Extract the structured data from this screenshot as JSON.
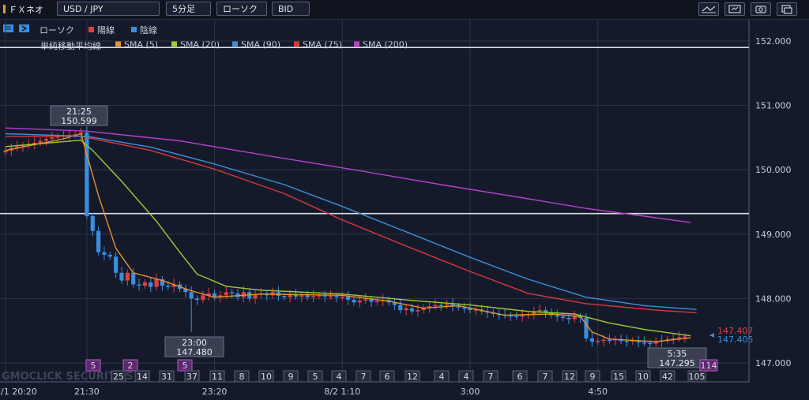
{
  "toolbar": {
    "app_name": "ＦＸネオ",
    "pair": "USD / JPY",
    "timeframe": "5分足",
    "chart_style": "ローソク",
    "price_side": "BID"
  },
  "legend": {
    "candle_label": "ローソク",
    "up_label": "陽線",
    "down_label": "陰線",
    "indicator_label": "単純移動平均線",
    "sma": [
      {
        "label": "SMA (5)",
        "color": "#e8922e"
      },
      {
        "label": "SMA (20)",
        "color": "#9acd32"
      },
      {
        "label": "SMA (90)",
        "color": "#3d8fd8"
      },
      {
        "label": "SMA (75)",
        "color": "#d63a3a"
      },
      {
        "label": "SMA (200)",
        "color": "#b640c8"
      }
    ]
  },
  "colors": {
    "up": "#e04040",
    "down": "#3a8ee0",
    "background": "#151a2b",
    "grid": "#2e3448"
  },
  "watermark": "GMOCLICK SECURITIES",
  "chart_data": {
    "type": "candlestick",
    "ylim": [
      146.7,
      152.3
    ],
    "y_ticks": [
      "152.000",
      "151.000",
      "150.000",
      "149.000",
      "148.000",
      "147.000"
    ],
    "x_tick_labels": [
      "/1 20:20",
      "21:30",
      "23:20",
      "8/2 1:10",
      "3:00",
      "4:50"
    ],
    "x_tick_index": [
      0,
      14,
      36,
      58,
      80,
      102
    ],
    "horizontal_lines": [
      151.9,
      149.32
    ],
    "high_annotation": {
      "time": "21:25",
      "price": "150.599",
      "index": 13
    },
    "low_annotation": {
      "time": "23:00",
      "price": "147.480",
      "index": 32
    },
    "last_low_annotation": {
      "time": "5:35",
      "price": "147.295",
      "index": 111
    },
    "last_price_sell": "147.407",
    "last_price_buy": "147.405",
    "count_badges": [
      "5",
      "2",
      "5",
      "25",
      "14",
      "31",
      "37",
      "11",
      "8",
      "10",
      "9",
      "5",
      "4",
      "7",
      "6",
      "12",
      "4",
      "4",
      "7",
      "6",
      "7",
      "12",
      "9",
      "15",
      "10",
      "42",
      "105",
      "114"
    ],
    "closes": [
      150.3,
      150.34,
      150.36,
      150.38,
      150.4,
      150.42,
      150.45,
      150.48,
      150.5,
      150.52,
      150.53,
      150.54,
      150.55,
      150.58,
      149.28,
      149.05,
      148.72,
      148.68,
      148.65,
      148.4,
      148.28,
      148.4,
      148.22,
      148.2,
      148.25,
      148.18,
      148.3,
      148.2,
      148.18,
      148.22,
      148.15,
      148.1,
      148.0,
      147.98,
      148.05,
      148.08,
      148.02,
      148.05,
      148.1,
      148.08,
      148.02,
      148.1,
      148.0,
      148.06,
      148.08,
      148.05,
      148.1,
      148.04,
      148.02,
      148.06,
      148.03,
      148.05,
      148.02,
      148.04,
      148.05,
      148.03,
      148.04,
      148.02,
      148.03,
      147.98,
      147.94,
      147.97,
      147.99,
      147.95,
      147.96,
      147.98,
      147.94,
      147.9,
      147.82,
      147.85,
      147.8,
      147.82,
      147.86,
      147.88,
      147.9,
      147.89,
      147.91,
      147.88,
      147.86,
      147.85,
      147.82,
      147.83,
      147.8,
      147.78,
      147.76,
      147.75,
      147.74,
      147.73,
      147.72,
      147.74,
      147.76,
      147.8,
      147.82,
      147.78,
      147.74,
      147.72,
      147.7,
      147.68,
      147.72,
      147.7,
      147.38,
      147.33,
      147.34,
      147.36,
      147.35,
      147.37,
      147.34,
      147.33,
      147.35,
      147.32,
      147.31,
      147.3,
      147.33,
      147.35,
      147.37,
      147.38,
      147.4,
      147.41
    ],
    "series": [
      {
        "name": "SMA (5)",
        "color": "#e8922e",
        "points": [
          [
            0,
            150.3
          ],
          [
            10,
            150.48
          ],
          [
            13,
            150.56
          ],
          [
            16,
            149.6
          ],
          [
            19,
            148.78
          ],
          [
            22,
            148.4
          ],
          [
            27,
            148.28
          ],
          [
            32,
            148.12
          ],
          [
            36,
            148.02
          ],
          [
            44,
            148.07
          ],
          [
            58,
            148.05
          ],
          [
            66,
            147.96
          ],
          [
            72,
            147.85
          ],
          [
            78,
            147.89
          ],
          [
            86,
            147.74
          ],
          [
            94,
            147.76
          ],
          [
            99,
            147.72
          ],
          [
            101,
            147.48
          ],
          [
            104,
            147.37
          ],
          [
            112,
            147.33
          ],
          [
            118,
            147.39
          ]
        ]
      },
      {
        "name": "SMA (20)",
        "color": "#9acd32",
        "points": [
          [
            0,
            150.36
          ],
          [
            13,
            150.46
          ],
          [
            15,
            150.3
          ],
          [
            20,
            149.82
          ],
          [
            26,
            149.2
          ],
          [
            30,
            148.72
          ],
          [
            33,
            148.38
          ],
          [
            38,
            148.19
          ],
          [
            44,
            148.13
          ],
          [
            58,
            148.07
          ],
          [
            70,
            147.97
          ],
          [
            80,
            147.9
          ],
          [
            90,
            147.8
          ],
          [
            98,
            147.76
          ],
          [
            104,
            147.62
          ],
          [
            110,
            147.52
          ],
          [
            118,
            147.42
          ]
        ]
      },
      {
        "name": "SMA (75)",
        "color": "#d63a3a",
        "points": [
          [
            0,
            150.52
          ],
          [
            13,
            150.52
          ],
          [
            25,
            150.3
          ],
          [
            36,
            150.01
          ],
          [
            48,
            149.63
          ],
          [
            58,
            149.22
          ],
          [
            70,
            148.78
          ],
          [
            80,
            148.42
          ],
          [
            90,
            148.08
          ],
          [
            100,
            147.92
          ],
          [
            112,
            147.82
          ],
          [
            119,
            147.78
          ]
        ]
      },
      {
        "name": "SMA (90)",
        "color": "#3d8fd8",
        "points": [
          [
            0,
            150.56
          ],
          [
            14,
            150.52
          ],
          [
            25,
            150.35
          ],
          [
            36,
            150.09
          ],
          [
            48,
            149.77
          ],
          [
            58,
            149.43
          ],
          [
            70,
            149.0
          ],
          [
            80,
            148.64
          ],
          [
            90,
            148.3
          ],
          [
            100,
            148.02
          ],
          [
            110,
            147.89
          ],
          [
            119,
            147.83
          ]
        ]
      },
      {
        "name": "SMA (200)",
        "color": "#b640c8",
        "points": [
          [
            0,
            150.65
          ],
          [
            14,
            150.6
          ],
          [
            30,
            150.45
          ],
          [
            45,
            150.22
          ],
          [
            60,
            150.0
          ],
          [
            75,
            149.77
          ],
          [
            88,
            149.58
          ],
          [
            100,
            149.4
          ],
          [
            110,
            149.28
          ],
          [
            118,
            149.18
          ]
        ]
      }
    ]
  }
}
